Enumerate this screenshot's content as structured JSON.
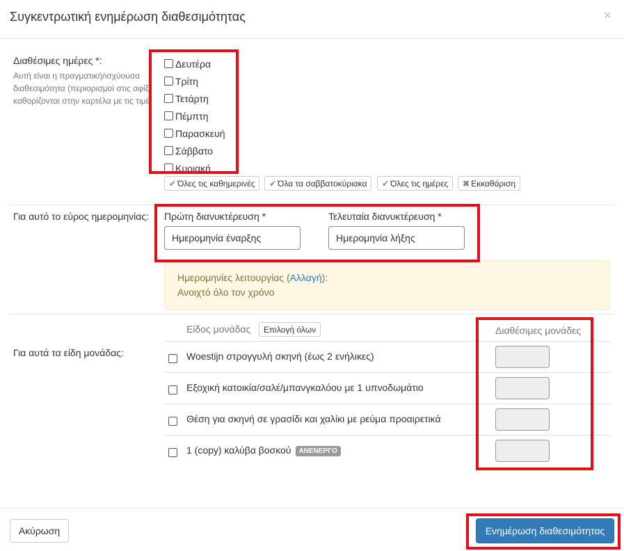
{
  "modal": {
    "title": "Συγκεντρωτική ενημέρωση διαθεσιμότητας",
    "close": "×"
  },
  "days_section": {
    "label": "Διαθέσιμες ημέρες *:",
    "help_lines": [
      "Αυτή είναι η πραγματική/ισχύουσα",
      "διαθεσιμότητα (περιορισμοί στις αφίξεις",
      "καθορίζονται στην καρτέλα με τις τιμές)"
    ],
    "days": [
      "Δευτέρα",
      "Τρίτη",
      "Τετάρτη",
      "Πέμπτη",
      "Παρασκευή",
      "Σάββατο",
      "Κυριακή"
    ],
    "buttons": {
      "weekdays": "Όλες τις καθημερινές",
      "weekends": "Όλα τα σαββατοκύριακα",
      "all_days": "Όλες τις ημέρες",
      "clear": "Εκκαθάριση"
    }
  },
  "date_section": {
    "label": "Για αυτό το εύρος ημερομηνίας:",
    "first_label": "Πρώτη διανυκτέρευση *",
    "first_placeholder": "Ημερομηνία έναρξης",
    "last_label": "Τελευταία διανυκτέρευση *",
    "last_placeholder": "Ημερομηνία λήξης",
    "alert_prefix": "Ημερομηνίες λειτουργίας (",
    "alert_link": "Αλλαγή",
    "alert_suffix": "):",
    "alert_value": "Ανοιχτό όλο τον χρόνο"
  },
  "units_section": {
    "label": "Για αυτά τα είδη μονάδας:",
    "col_type": "Είδος μονάδας",
    "select_all": "Επιλογή όλων",
    "col_available": "Διαθέσιμες μονάδες",
    "rows": [
      {
        "name": "Woestijn στρογγυλή σκηνή (έως 2 ενήλικες)",
        "badge": ""
      },
      {
        "name": "Εξοχική κατοικία/σαλέ/μπανγκαλόου με 1 υπνοδωμάτιο",
        "badge": ""
      },
      {
        "name": "Θέση για σκηνή σε γρασίδι και χαλίκι με ρεύμα προαιρετικά",
        "badge": ""
      },
      {
        "name": "1 (copy) καλύβα βοσκού",
        "badge": "ΑΝΕΝΕΡΓΟ"
      }
    ]
  },
  "footer": {
    "cancel": "Ακύρωση",
    "submit": "Ενημέρωση διαθεσιμότητας"
  }
}
